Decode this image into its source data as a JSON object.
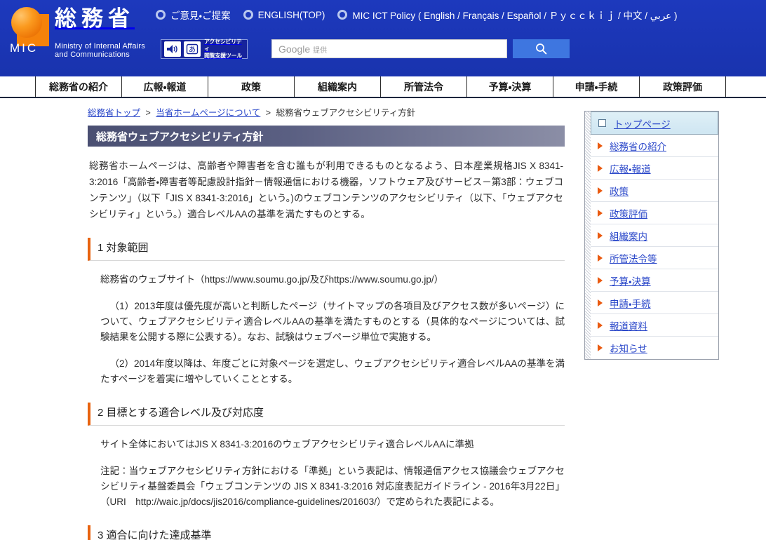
{
  "header": {
    "logo": {
      "jp_name": "総務省",
      "mic_abbr": "MIC",
      "en_line1": "Ministry of Internal Affairs",
      "en_line2": "and Communications"
    },
    "top_links": [
      {
        "label": "ご意見・ご提案"
      },
      {
        "label": "ENGLISH(TOP)"
      },
      {
        "label": "MIC ICT Policy ( English / Français / Español / Ｐｙｃｃｋｉｊ / 中文 / عربي )"
      }
    ],
    "accessibility_tool": {
      "line1": "アクセシビリティ",
      "line2": "閲覧支援ツール",
      "speaker_icon": "speaker-icon",
      "kana_icon": "kana-a-icon"
    },
    "search": {
      "placeholder_main": "Google",
      "placeholder_sub": "提供",
      "value": "",
      "button_icon": "search-icon"
    }
  },
  "global_nav": [
    {
      "label": "総務省の紹介"
    },
    {
      "label": "広報・報道"
    },
    {
      "label": "政策"
    },
    {
      "label": "組織案内"
    },
    {
      "label": "所管法令"
    },
    {
      "label": "予算・決算"
    },
    {
      "label": "申請・手続"
    },
    {
      "label": "政策評価"
    }
  ],
  "breadcrumb": {
    "items": [
      {
        "label": "総務省トップ",
        "link": true
      },
      {
        "label": "当省ホームページについて",
        "link": true
      },
      {
        "label": "総務省ウェブアクセシビリティ方針",
        "link": false
      }
    ],
    "separator": ">"
  },
  "page_title": "総務省ウェブアクセシビリティ方針",
  "main": {
    "lead": "総務省ホームページは、高齢者や障害者を含む誰もが利用できるものとなるよう、日本産業規格JIS X 8341-3:2016「高齢者・障害者等配慮設計指針－情報通信における機器，ソフトウェア及びサービス－第3部：ウェブコンテンツ」（以下「JIS X 8341-3:2016」という。)のウェブコンテンツのアクセシビリティ（以下、「ウェブアクセシビリティ」という。）適合レベルAAの基準を満たすものとする。",
    "sections": [
      {
        "heading": "1 対象範囲",
        "paragraphs": [
          "総務省のウェブサイト（https://www.soumu.go.jp/及びhttps://www.soumu.go.jp/）",
          "（1）2013年度は優先度が高いと判断したページ（サイトマップの各項目及びアクセス数が多いページ）について、ウェブアクセシビリティ適合レベルAAの基準を満たすものとする（具体的なページについては、試験結果を公開する際に公表する）。なお、試験はウェブページ単位で実施する。",
          "（2）2014年度以降は、年度ごとに対象ページを選定し、ウェブアクセシビリティ適合レベルAAの基準を満たすページを着実に増やしていくこととする。"
        ]
      },
      {
        "heading": "2 目標とする適合レベル及び対応度",
        "paragraphs": [
          "サイト全体においてはJIS X 8341-3:2016のウェブアクセシビリティ適合レベルAAに準拠",
          "注記：当ウェブアクセシビリティ方針における「準拠」という表記は、情報通信アクセス協議会ウェブアクセシビリティ基盤委員会「ウェブコンテンツの JIS X 8341-3:2016 対応度表記ガイドライン - 2016年3月22日」（URI　http://waic.jp/docs/jis2016/compliance-guidelines/201603/）で定められた表記による。"
        ]
      },
      {
        "heading": "3 適合に向けた達成基準"
      }
    ]
  },
  "sidebar": {
    "items": [
      {
        "label": "トップページ",
        "marker": "square",
        "selected": true
      },
      {
        "label": "総務省の紹介",
        "marker": "triangle",
        "selected": false
      },
      {
        "label": "広報・報道",
        "marker": "triangle",
        "selected": false
      },
      {
        "label": "政策",
        "marker": "triangle",
        "selected": false
      },
      {
        "label": "政策評価",
        "marker": "triangle",
        "selected": false
      },
      {
        "label": "組織案内",
        "marker": "triangle",
        "selected": false
      },
      {
        "label": "所管法令等",
        "marker": "triangle",
        "selected": false
      },
      {
        "label": "予算・決算",
        "marker": "triangle",
        "selected": false
      },
      {
        "label": "申請・手続",
        "marker": "triangle",
        "selected": false
      },
      {
        "label": "報道資料",
        "marker": "triangle",
        "selected": false
      },
      {
        "label": "お知らせ",
        "marker": "triangle",
        "selected": false
      }
    ]
  },
  "colors": {
    "header_blue": "#1b35b5",
    "accent_orange": "#e8630f",
    "link_blue": "#2a47c9",
    "title_gradient_start": "#4a4f72",
    "title_gradient_end": "#8b8ea6",
    "search_button": "#3e76e0"
  }
}
